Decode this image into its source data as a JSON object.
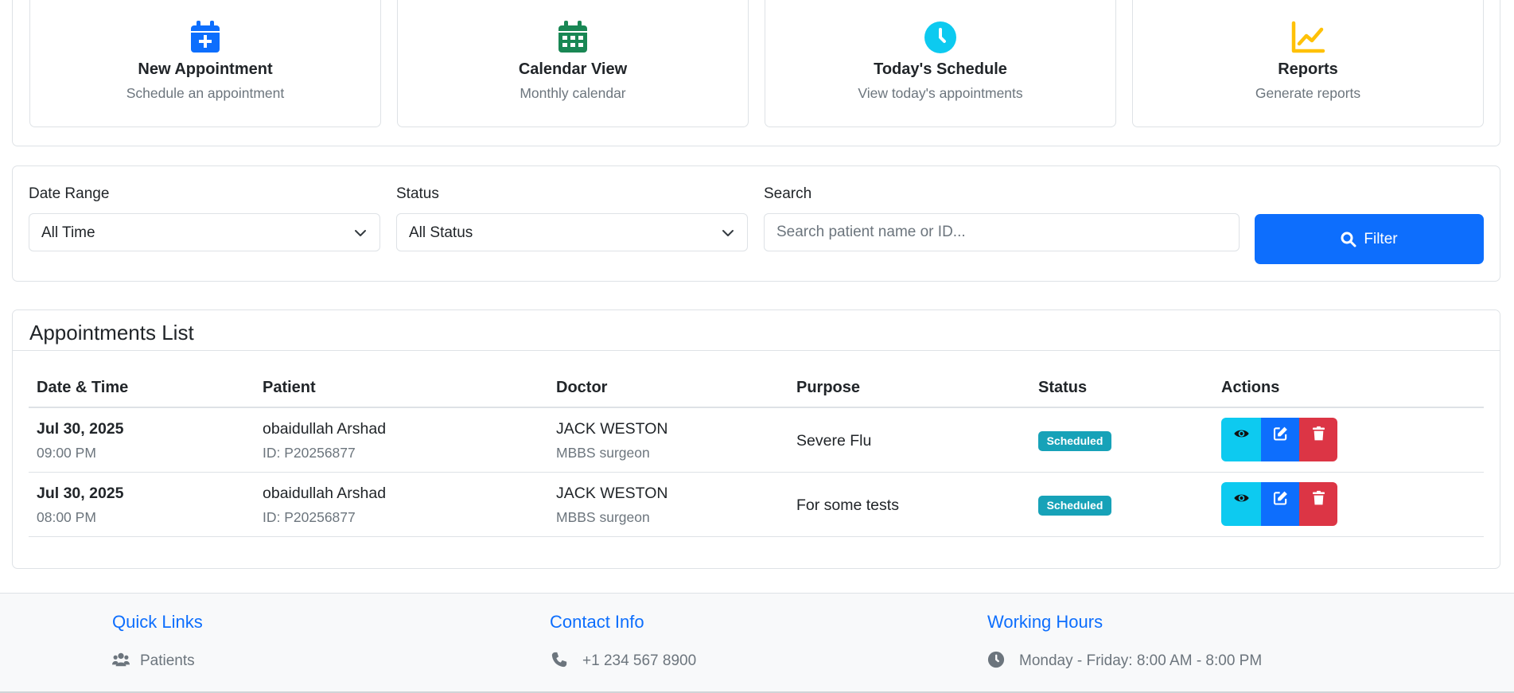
{
  "quick_actions": [
    {
      "title": "New Appointment",
      "subtitle": "Schedule an appointment",
      "icon": "calendar-plus-icon",
      "color": "#0d6efd"
    },
    {
      "title": "Calendar View",
      "subtitle": "Monthly calendar",
      "icon": "calendar-grid-icon",
      "color": "#198754"
    },
    {
      "title": "Today's Schedule",
      "subtitle": "View today's appointments",
      "icon": "clock-icon",
      "color": "#0dcaf0"
    },
    {
      "title": "Reports",
      "subtitle": "Generate reports",
      "icon": "chart-line-icon",
      "color": "#ffc107"
    }
  ],
  "filters": {
    "date_range_label": "Date Range",
    "date_range_value": "All Time",
    "status_label": "Status",
    "status_value": "All Status",
    "search_label": "Search",
    "search_placeholder": "Search patient name or ID...",
    "filter_button": "Filter"
  },
  "appointments": {
    "title": "Appointments List",
    "columns": [
      "Date & Time",
      "Patient",
      "Doctor",
      "Purpose",
      "Status",
      "Actions"
    ],
    "rows": [
      {
        "date": "Jul 30, 2025",
        "time": "09:00 PM",
        "patient": "obaidullah Arshad",
        "patient_id": "ID: P20256877",
        "doctor": "JACK WESTON",
        "specialty": "MBBS surgeon",
        "purpose": "Severe Flu",
        "status": "Scheduled"
      },
      {
        "date": "Jul 30, 2025",
        "time": "08:00 PM",
        "patient": "obaidullah Arshad",
        "patient_id": "ID: P20256877",
        "doctor": "JACK WESTON",
        "specialty": "MBBS surgeon",
        "purpose": "For some tests",
        "status": "Scheduled"
      }
    ]
  },
  "footer": {
    "quick_links": {
      "heading": "Quick Links",
      "item": "Patients"
    },
    "contact": {
      "heading": "Contact Info",
      "phone": "+1 234 567 8900"
    },
    "hours": {
      "heading": "Working Hours",
      "text": "Monday - Friday: 8:00 AM - 8:00 PM"
    }
  },
  "colors": {
    "primary": "#0d6efd",
    "info": "#0dcaf0",
    "danger": "#dc3545",
    "badge": "#17a2b8",
    "muted": "#6c757d"
  }
}
